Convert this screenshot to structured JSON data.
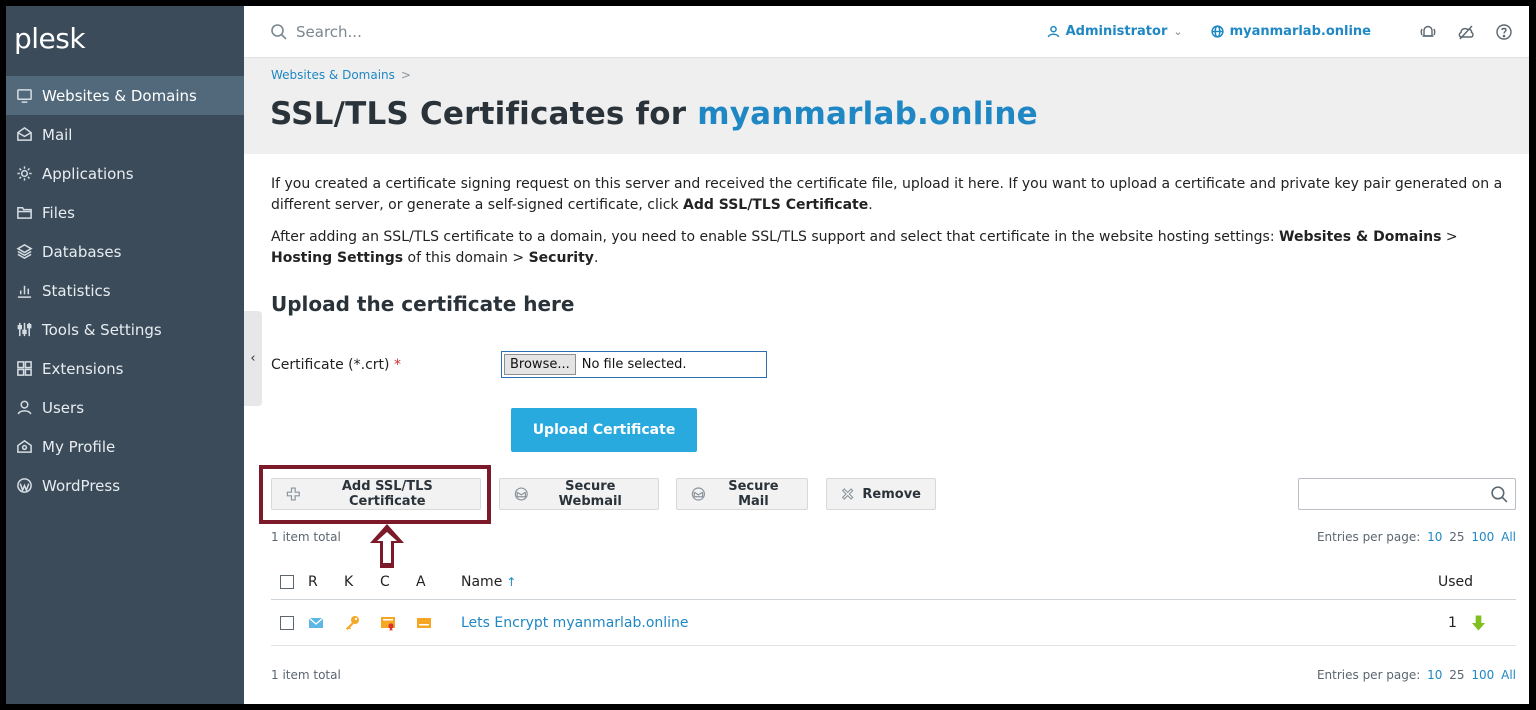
{
  "app": {
    "logo": "plesk"
  },
  "sidebar": {
    "items": [
      {
        "label": "Websites & Domains",
        "icon": "monitor-icon",
        "active": true
      },
      {
        "label": "Mail",
        "icon": "mail-icon"
      },
      {
        "label": "Applications",
        "icon": "gear-icon"
      },
      {
        "label": "Files",
        "icon": "folder-icon"
      },
      {
        "label": "Databases",
        "icon": "database-icon"
      },
      {
        "label": "Statistics",
        "icon": "bar-chart-icon"
      },
      {
        "label": "Tools & Settings",
        "icon": "sliders-icon"
      },
      {
        "label": "Extensions",
        "icon": "grid-icon"
      },
      {
        "label": "Users",
        "icon": "user-icon"
      },
      {
        "label": "My Profile",
        "icon": "profile-icon"
      },
      {
        "label": "WordPress",
        "icon": "wordpress-icon"
      }
    ]
  },
  "topbar": {
    "search_placeholder": "Search...",
    "user": "Administrator",
    "domain": "myanmarlab.online"
  },
  "header": {
    "breadcrumb": "Websites & Domains",
    "breadcrumb_sep": ">",
    "title_prefix": "SSL/TLS Certificates for ",
    "title_domain": "myanmarlab.online"
  },
  "intro": {
    "p1_text": "If you created a certificate signing request on this server and received the certificate file, upload it here. If you want to upload a certificate and private key pair generated on a different server, or generate a self-signed certificate, click ",
    "p1_bold": "Add SSL/TLS Certificate",
    "p1_end": ".",
    "p2_text": "After adding an SSL/TLS certificate to a domain, you need to enable SSL/TLS support and select that certificate in the website hosting settings: ",
    "p2_b1": "Websites & Domains",
    "p2_mid1": " > ",
    "p2_b2": "Hosting Settings",
    "p2_mid2": " of this domain > ",
    "p2_b3": "Security",
    "p2_end": "."
  },
  "upload": {
    "section_title": "Upload the certificate here",
    "field_label": "Certificate (*.crt)",
    "required_mark": "*",
    "browse_label": "Browse...",
    "file_status": "No file selected.",
    "submit_label": "Upload Certificate"
  },
  "toolbar": {
    "add_label": "Add SSL/TLS Certificate",
    "secure_webmail_label": "Secure Webmail",
    "secure_mail_label": "Secure Mail",
    "remove_label": "Remove"
  },
  "list": {
    "total_text": "1 item total",
    "per_page_label": "Entries per page:",
    "per_page_options": [
      "10",
      "25",
      "100",
      "All"
    ],
    "columns": {
      "r": "R",
      "k": "K",
      "c": "C",
      "a": "A",
      "name": "Name",
      "sort_indicator": "↑",
      "used": "Used"
    },
    "rows": [
      {
        "name": "Lets Encrypt myanmarlab.online",
        "used": "1"
      }
    ]
  },
  "colors": {
    "accent": "#1f87c3",
    "sidebar": "#3b4b59",
    "primary_button": "#28aade",
    "highlight": "#7d1a2a"
  }
}
